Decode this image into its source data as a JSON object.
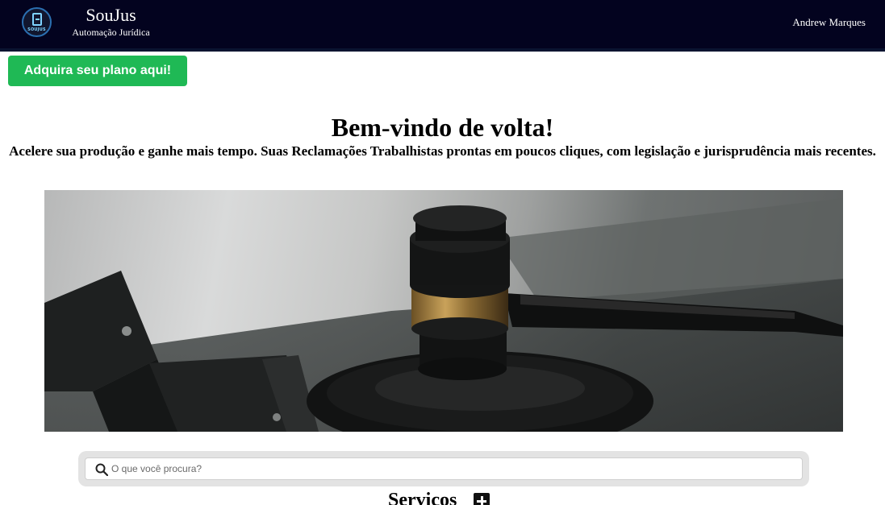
{
  "header": {
    "logo_text": "SOUJUS",
    "brand_title": "SouJus",
    "brand_subtitle": "Automação Jurídica",
    "user_name": "Andrew Marques"
  },
  "cta": {
    "label": "Adquira seu plano aqui!"
  },
  "hero": {
    "title": "Bem-vindo de volta!",
    "subtitle": "Acelere sua produção e ganhe mais tempo. Suas Reclamações Trabalhistas prontas em poucos cliques, com legislação e jurisprudência mais recentes."
  },
  "search": {
    "placeholder": "O que você procura?",
    "value": ""
  },
  "services": {
    "title": "Serviços"
  },
  "icons": {
    "logo": "soujus-logo",
    "search": "search-icon",
    "add": "plus-square-icon"
  },
  "colors": {
    "header_bg": "#03031f",
    "cta_bg": "#1fb955",
    "search_frame": "#e3e3e3"
  }
}
